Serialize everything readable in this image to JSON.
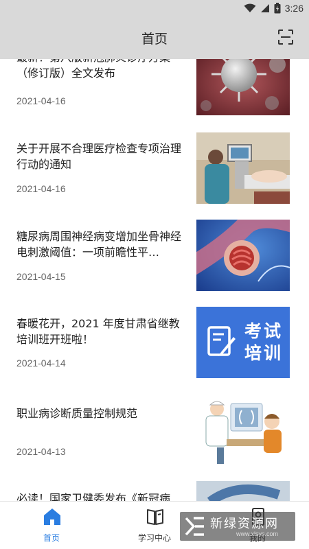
{
  "status_bar": {
    "time": "3:26"
  },
  "header": {
    "title": "首页",
    "scan_icon": "scan-icon"
  },
  "news": [
    {
      "title": "最新！第八版新冠肺炎诊疗方案（修订版）全文发布",
      "date": "2021-04-16",
      "thumb": "virus-image"
    },
    {
      "title": "关于开展不合理医疗检查专项治理行动的通知",
      "date": "2021-04-16",
      "thumb": "ultrasound-exam-image"
    },
    {
      "title": "糖尿病周围神经病变增加坐骨神经电刺激阈值：一项前瞻性平…",
      "date": "2021-04-15",
      "thumb": "nerve-illustration"
    },
    {
      "title": "春暖花开，2021 年度甘肃省继教培训班开班啦！",
      "date": "2021-04-14",
      "thumb": "exam-training-banner",
      "thumb_text": [
        "考试",
        "培训"
      ]
    },
    {
      "title": "职业病诊断质量控制规范",
      "date": "2021-04-13",
      "thumb": "doctor-xray-illustration"
    },
    {
      "title": "必读！国家卫健委发布《新冠病",
      "date": "",
      "thumb": "partial-image"
    }
  ],
  "tabs": [
    {
      "label": "首页",
      "icon": "home-icon",
      "active": true
    },
    {
      "label": "学习中心",
      "icon": "book-icon",
      "active": false
    },
    {
      "label": "我的",
      "icon": "profile-icon",
      "active": false
    }
  ],
  "watermark": {
    "text": "新绿资源网",
    "url": "www.xlsys.com"
  },
  "colors": {
    "bar_bg": "#d9d9d9",
    "accent": "#2a7de1",
    "banner_blue": "#3b73d9"
  }
}
